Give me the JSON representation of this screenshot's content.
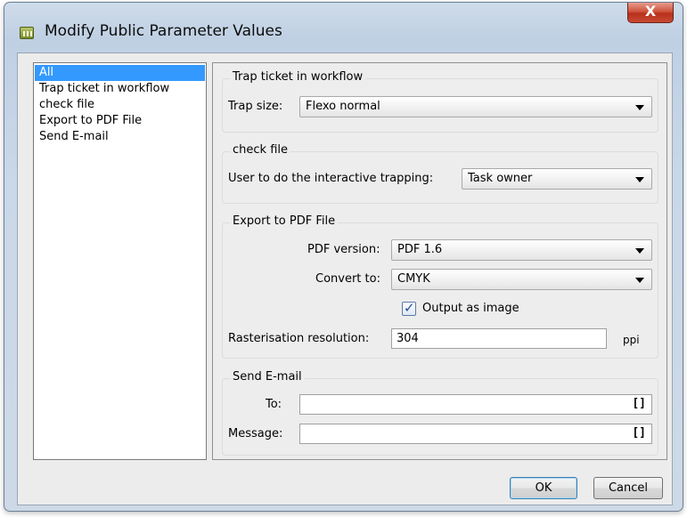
{
  "window": {
    "title": "Modify Public Parameter Values",
    "close_label": "X"
  },
  "sidebar": {
    "items": [
      {
        "label": "All",
        "selected": true
      },
      {
        "label": "Trap ticket in workflow",
        "selected": false
      },
      {
        "label": "check file",
        "selected": false
      },
      {
        "label": "Export to PDF File",
        "selected": false
      },
      {
        "label": "Send E-mail",
        "selected": false
      }
    ]
  },
  "trap": {
    "title": "Trap ticket in workflow",
    "size_label": "Trap size:",
    "size_value": "Flexo normal"
  },
  "check": {
    "title": "check file",
    "user_label": "User to do the interactive trapping:",
    "user_value": "Task owner"
  },
  "export": {
    "title": "Export to PDF File",
    "version_label": "PDF version:",
    "version_value": "PDF 1.6",
    "convert_label": "Convert to:",
    "convert_value": "CMYK",
    "output_image_label": "Output as image",
    "output_image_checked": true,
    "resolution_label": "Rasterisation resolution:",
    "resolution_value": "304",
    "resolution_unit": "ppi"
  },
  "email": {
    "title": "Send E-mail",
    "to_label": "To:",
    "to_value": "",
    "to_icon": "[]",
    "message_label": "Message:",
    "message_value": "",
    "message_icon": "[]"
  },
  "buttons": {
    "ok": "OK",
    "cancel": "Cancel"
  }
}
